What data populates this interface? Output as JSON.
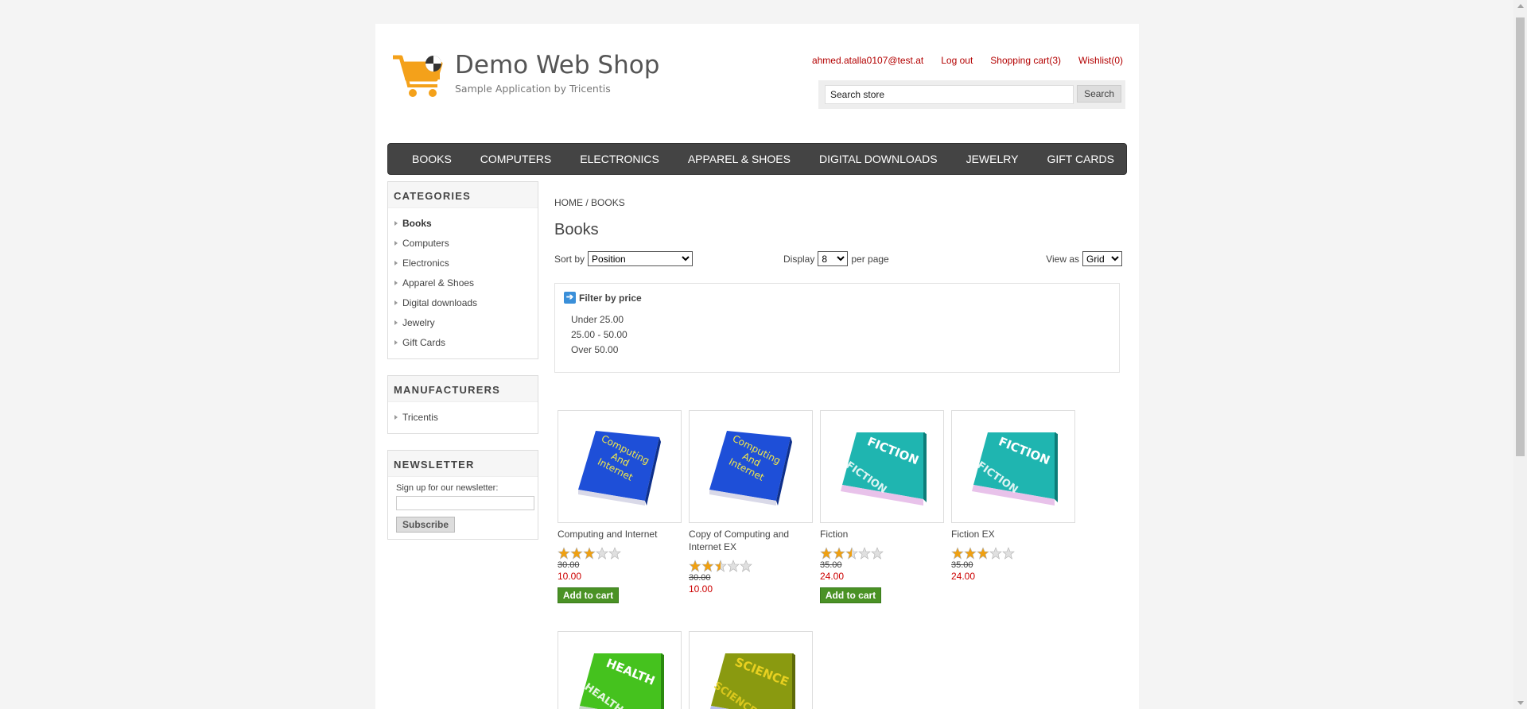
{
  "header": {
    "title": "Demo Web Shop",
    "subtitle": "Sample Application by Tricentis",
    "links": {
      "account": "ahmed.atalla0107@test.at",
      "logout": "Log out",
      "cart": "Shopping cart(3)",
      "wishlist": "Wishlist(0)"
    },
    "search": {
      "value": "Search store",
      "button": "Search"
    }
  },
  "top_menu": [
    "BOOKS",
    "COMPUTERS",
    "ELECTRONICS",
    "APPAREL & SHOES",
    "DIGITAL DOWNLOADS",
    "JEWELRY",
    "GIFT CARDS"
  ],
  "categories": {
    "title": "CATEGORIES",
    "items": [
      "Books",
      "Computers",
      "Electronics",
      "Apparel & Shoes",
      "Digital downloads",
      "Jewelry",
      "Gift Cards"
    ],
    "active": "Books"
  },
  "manufacturers": {
    "title": "MANUFACTURERS",
    "items": [
      "Tricentis"
    ]
  },
  "newsletter": {
    "title": "NEWSLETTER",
    "label": "Sign up for our newsletter:",
    "button": "Subscribe"
  },
  "breadcrumb": {
    "home": "HOME",
    "sep": "/",
    "current": "BOOKS"
  },
  "page_title": "Books",
  "selectors": {
    "sort_label": "Sort by",
    "sort_value": "Position",
    "display_label": "Display",
    "display_value": "8",
    "per_page": "per page",
    "view_label": "View as",
    "view_value": "Grid"
  },
  "filter": {
    "title": "Filter by price",
    "options": [
      "Under 25.00",
      "25.00 - 50.00",
      "Over 50.00"
    ]
  },
  "products": [
    {
      "title": "Computing and Internet",
      "rating": 3,
      "old_price": "30.00",
      "price": "10.00",
      "button": "Add to cart",
      "cover": "computing"
    },
    {
      "title": "Copy of Computing and Internet EX",
      "rating": 2.5,
      "old_price": "30.00",
      "price": "10.00",
      "button": "",
      "cover": "computing"
    },
    {
      "title": "Fiction",
      "rating": 2.5,
      "old_price": "35.00",
      "price": "24.00",
      "button": "Add to cart",
      "cover": "fiction"
    },
    {
      "title": "Fiction EX",
      "rating": 3,
      "old_price": "35.00",
      "price": "24.00",
      "button": "",
      "cover": "fiction"
    },
    {
      "title": "",
      "rating": 0,
      "old_price": "",
      "price": "",
      "button": "",
      "cover": "health"
    },
    {
      "title": "",
      "rating": 0,
      "old_price": "",
      "price": "",
      "button": "",
      "cover": "science"
    }
  ],
  "cover_text": {
    "computing": [
      "Computing",
      "And",
      "Internet"
    ],
    "fiction": "FICTION",
    "health": "HEALTH",
    "science": "SCIENCE"
  },
  "colors": {
    "accent_red": "#b30000",
    "price_red": "#cc0000",
    "menu_bg": "#444444",
    "add_cart_green": "#4a9225",
    "star_gold": "#f0a010"
  }
}
